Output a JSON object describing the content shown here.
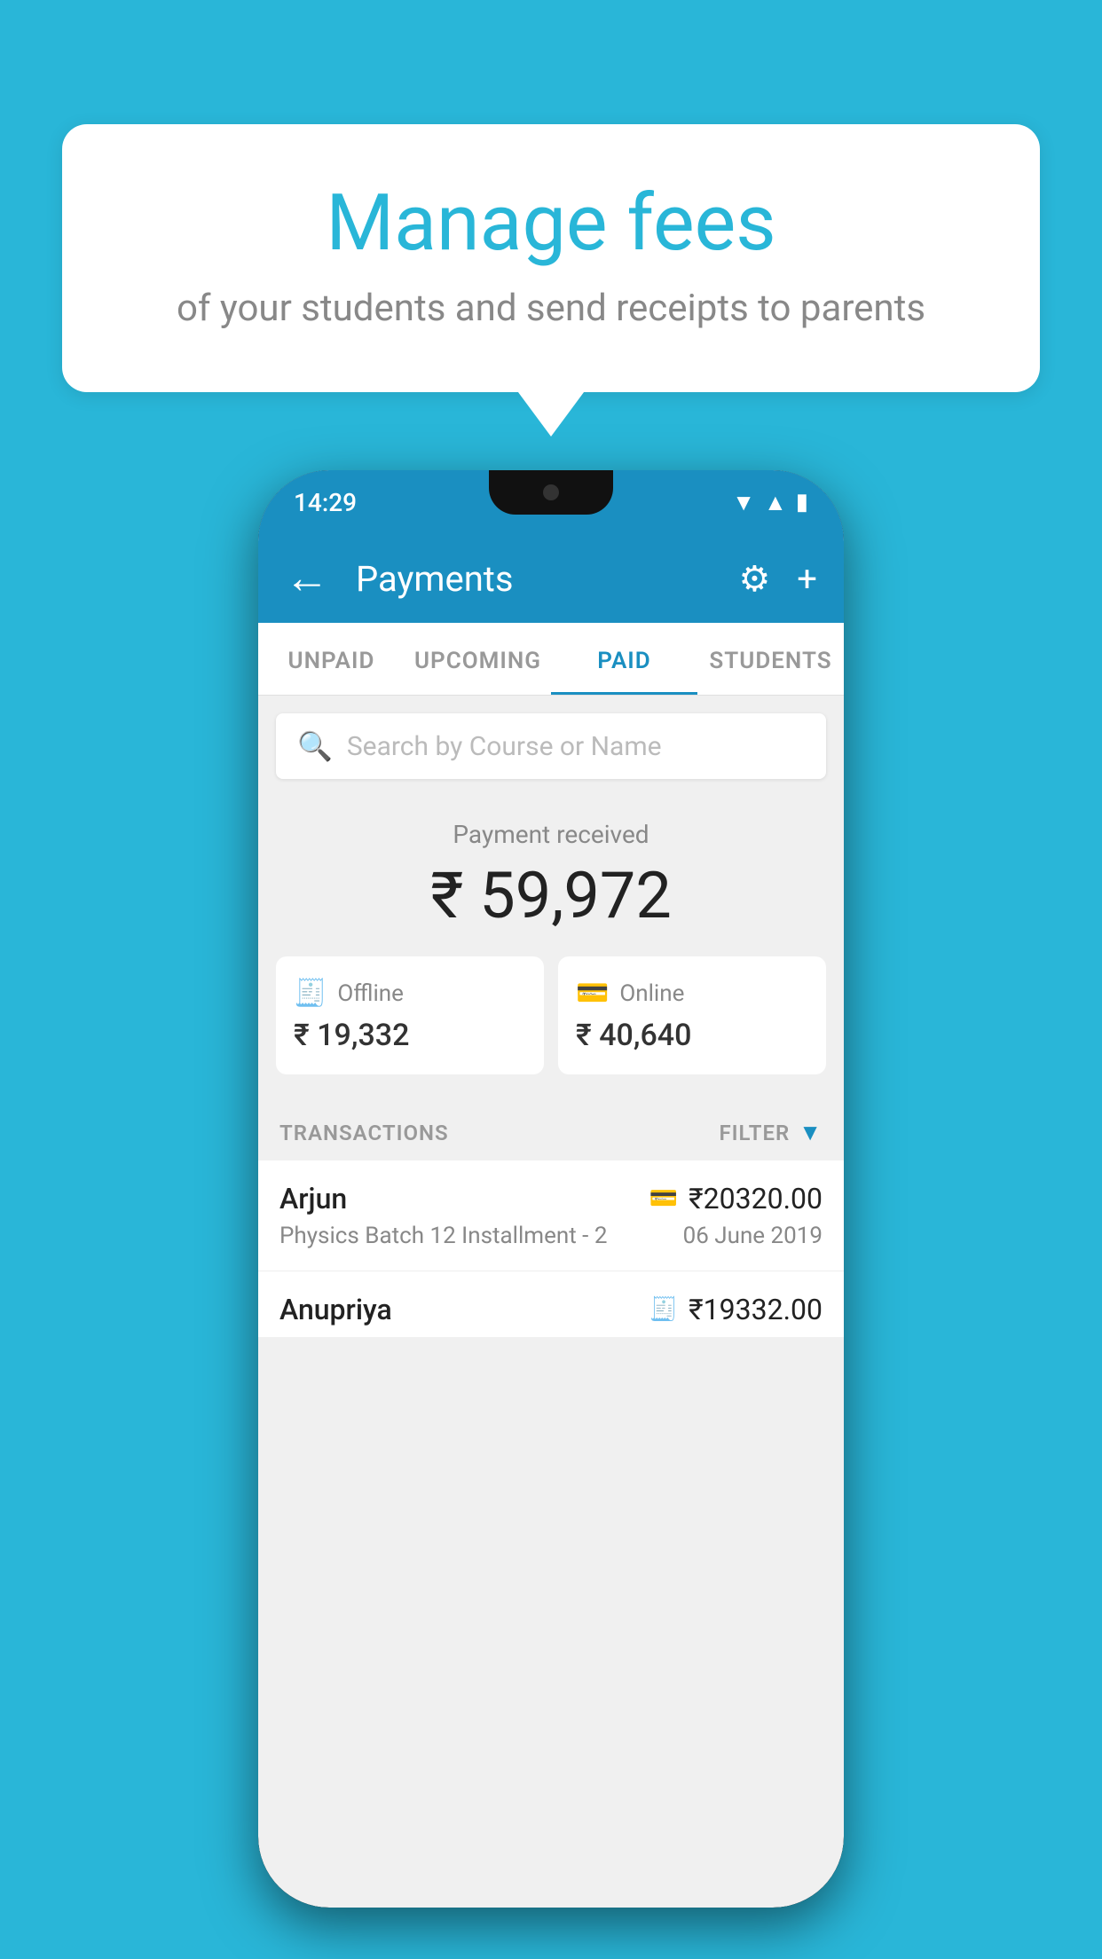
{
  "background_color": "#29b6d8",
  "speech_bubble": {
    "title": "Manage fees",
    "subtitle": "of your students and send receipts to parents"
  },
  "status_bar": {
    "time": "14:29"
  },
  "app_bar": {
    "title": "Payments",
    "back_label": "←",
    "settings_label": "⚙",
    "add_label": "+"
  },
  "tabs": [
    {
      "id": "unpaid",
      "label": "UNPAID",
      "active": false
    },
    {
      "id": "upcoming",
      "label": "UPCOMING",
      "active": false
    },
    {
      "id": "paid",
      "label": "PAID",
      "active": true
    },
    {
      "id": "students",
      "label": "STUDENTS",
      "active": false
    }
  ],
  "search": {
    "placeholder": "Search by Course or Name"
  },
  "payment_summary": {
    "label": "Payment received",
    "amount": "₹ 59,972",
    "offline": {
      "label": "Offline",
      "amount": "₹ 19,332"
    },
    "online": {
      "label": "Online",
      "amount": "₹ 40,640"
    }
  },
  "transactions": {
    "header_label": "TRANSACTIONS",
    "filter_label": "FILTER",
    "items": [
      {
        "name": "Arjun",
        "description": "Physics Batch 12 Installment - 2",
        "amount": "₹20320.00",
        "date": "06 June 2019",
        "payment_type": "online"
      },
      {
        "name": "Anupriya",
        "description": "",
        "amount": "₹19332.00",
        "date": "",
        "payment_type": "offline"
      }
    ]
  }
}
